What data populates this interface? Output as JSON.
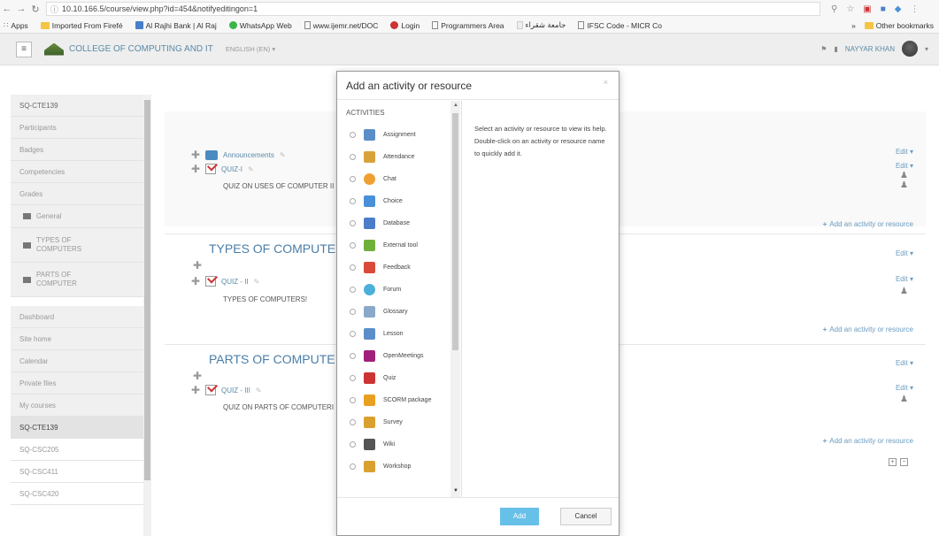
{
  "browser": {
    "url": "10.10.166.5/course/view.php?id=454&notifyeditingon=1",
    "bookmarks": [
      "Apps",
      "Imported From Firefé",
      "Al Rajhi Bank | Al Raj",
      "WhatsApp Web",
      "www.ijemr.net/DOC",
      "Login",
      "Programmers Area",
      "جامعة شقراء",
      "IFSC Code - MICR Co"
    ],
    "other_bookmarks": "Other bookmarks",
    "more": "»"
  },
  "navbar": {
    "site_name": "COLLEGE OF COMPUTING AND IT",
    "language": "ENGLISH (EN) ▾",
    "user_name": "NAYYAR KHAN"
  },
  "sidebar": {
    "course": "SQ-CTE139",
    "items": [
      "Participants",
      "Badges",
      "Competencies",
      "Grades"
    ],
    "sections": [
      "General",
      "TYPES OF COMPUTERS",
      "PARTS OF COMPUTER"
    ],
    "nav": [
      "Dashboard",
      "Site home",
      "Calendar",
      "Private files",
      "My courses"
    ],
    "courses": [
      "SQ-CTE139",
      "SQ-CSC205",
      "SQ-CSC411",
      "SQ-CSC420"
    ]
  },
  "main": {
    "edit_label": "Edit ▾",
    "add_activity": "Add an activity or resource",
    "sections": [
      {
        "title": "",
        "activities": [
          {
            "name": "Announcements"
          },
          {
            "name": "QUIZ-I",
            "description": "QUIZ ON USES OF COMPUTER II"
          }
        ]
      },
      {
        "title": "TYPES OF COMPUTE",
        "activities": [
          {
            "name": "QUIZ - II",
            "description": "TYPES OF COMPUTERS!"
          }
        ]
      },
      {
        "title": "PARTS OF COMPUTE",
        "activities": [
          {
            "name": "QUIZ - III",
            "description": "QUIZ ON PARTS OF COMPUTERI"
          }
        ]
      }
    ]
  },
  "modal": {
    "title": "Add an activity or resource",
    "close": "×",
    "list_header": "ACTIVITIES",
    "options": [
      {
        "label": "Assignment",
        "icon": "assignment-icon",
        "color": "#5a8ec9"
      },
      {
        "label": "Attendance",
        "icon": "attendance-icon",
        "color": "#d8a23a"
      },
      {
        "label": "Chat",
        "icon": "chat-icon",
        "color": "#f0a030"
      },
      {
        "label": "Choice",
        "icon": "choice-icon",
        "color": "#4a90d9"
      },
      {
        "label": "Database",
        "icon": "database-icon",
        "color": "#4a7ec9"
      },
      {
        "label": "External tool",
        "icon": "external-tool-icon",
        "color": "#6fb03a"
      },
      {
        "label": "Feedback",
        "icon": "feedback-icon",
        "color": "#d94a3a"
      },
      {
        "label": "Forum",
        "icon": "forum-icon",
        "color": "#4ab0d9"
      },
      {
        "label": "Glossary",
        "icon": "glossary-icon",
        "color": "#8aa9c9"
      },
      {
        "label": "Lesson",
        "icon": "lesson-icon",
        "color": "#5a8ec9"
      },
      {
        "label": "OpenMeetings",
        "icon": "openmeetings-icon",
        "color": "#a0207a"
      },
      {
        "label": "Quiz",
        "icon": "quiz-icon",
        "color": "#c33"
      },
      {
        "label": "SCORM package",
        "icon": "scorm-icon",
        "color": "#e8a020"
      },
      {
        "label": "Survey",
        "icon": "survey-icon",
        "color": "#d9a030"
      },
      {
        "label": "Wiki",
        "icon": "wiki-icon",
        "color": "#555"
      },
      {
        "label": "Workshop",
        "icon": "workshop-icon",
        "color": "#d9a030"
      }
    ],
    "help_text": "Select an activity or resource to view its help. Double-click on an activity or resource name to quickly add it.",
    "add_label": "Add",
    "cancel_label": "Cancel"
  }
}
